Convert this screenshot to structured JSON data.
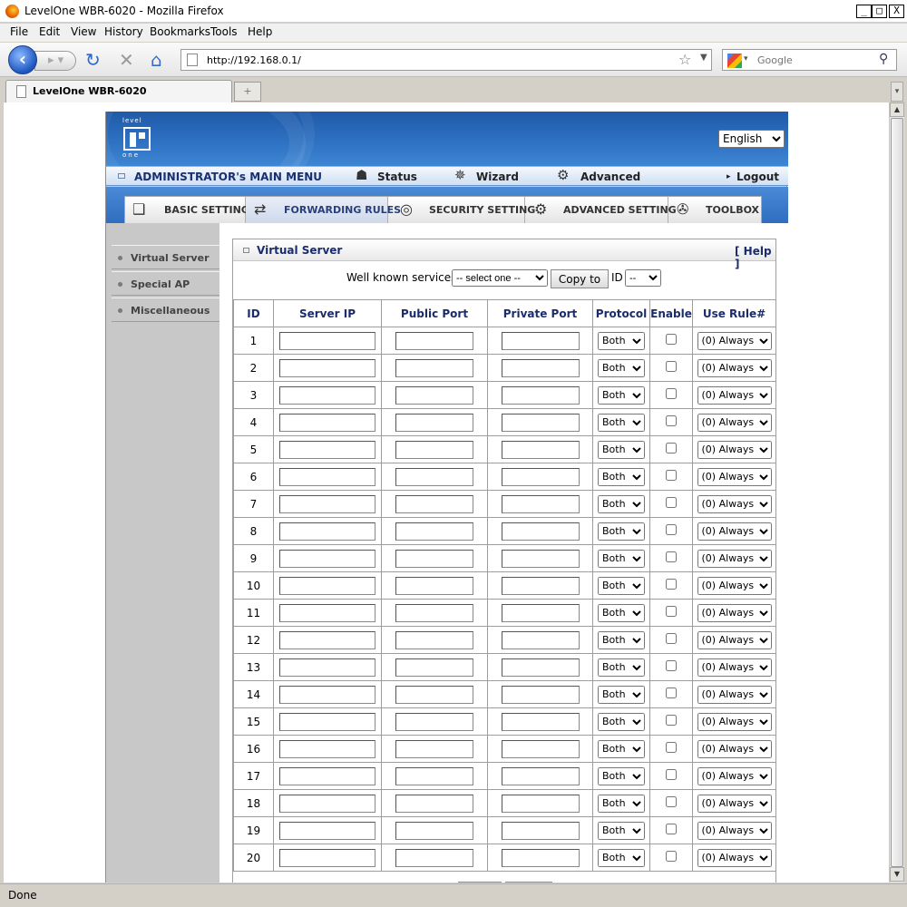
{
  "window": {
    "title": "LevelOne WBR-6020 - Mozilla Firefox",
    "minimize": "_",
    "maximize": "□",
    "close": "X"
  },
  "menubar": [
    "File",
    "Edit",
    "View",
    "History",
    "Bookmarks",
    "Tools",
    "Help"
  ],
  "navbar": {
    "url": "http://192.168.0.1/",
    "search_placeholder": "Google"
  },
  "tab": {
    "title": "LevelOne WBR-6020"
  },
  "statusbar": {
    "text": "Done"
  },
  "router": {
    "language": "English",
    "main_menu_label": "ADMINISTRATOR's MAIN MENU",
    "main_menu": [
      "Status",
      "Wizard",
      "Advanced",
      "Logout"
    ],
    "section_tabs": [
      "BASIC SETTING",
      "FORWARDING RULES",
      "SECURITY SETTING",
      "ADVANCED SETTING",
      "TOOLBOX"
    ],
    "active_tab": "FORWARDING RULES",
    "sidebar": [
      "Virtual Server",
      "Special AP",
      "Miscellaneous"
    ],
    "panel_title": "Virtual Server",
    "help": "[ Help ]",
    "well_known_label": "Well known services",
    "well_known_selected": "-- select one --",
    "copy_button": "Copy to",
    "id_label": "ID",
    "id_selected": "--",
    "columns": [
      "ID",
      "Server IP",
      "Public Port",
      "Private Port",
      "Protocol",
      "Enable",
      "Use Rule#"
    ],
    "protocol_default": "Both",
    "rule_default": "(0) Always",
    "rows": [
      "1",
      "2",
      "3",
      "4",
      "5",
      "6",
      "7",
      "8",
      "9",
      "10",
      "11",
      "12",
      "13",
      "14",
      "15",
      "16",
      "17",
      "18",
      "19",
      "20"
    ]
  },
  "colors": {
    "header_blue": "#2e71c2",
    "heading_text": "#1b2c6e",
    "sidebar_gray": "#c8c8c8"
  },
  "icons": {
    "back": "back-arrow-icon",
    "forward": "forward-arrow-icon",
    "reload": "reload-icon",
    "stop": "stop-icon",
    "home": "home-icon",
    "bookmark": "star-icon",
    "search": "magnifier-icon"
  }
}
